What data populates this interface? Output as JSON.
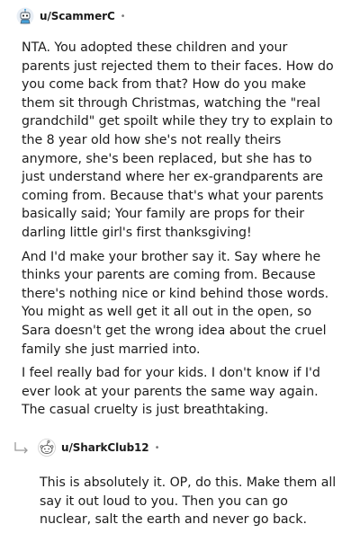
{
  "comments": [
    {
      "username": "u/ScammerC",
      "separator": "•",
      "avatar_icon": "robot-avatar-icon",
      "paragraphs": [
        "NTA. You adopted these children and your parents just rejected them to their faces. How do you come back from that? How do you make them sit through Christmas, watching the \"real grandchild\" get spoilt while they try to explain to the 8 year old how she's not really theirs anymore, she's been replaced, but she has to just understand where her ex-grandparents are coming from. Because that's what your parents basically said; Your family are props for their darling little girl's first thanksgiving!",
        "And I'd make your brother say it. Say where he thinks your parents are coming from. Because there's nothing nice or kind behind those words. You might as well get it all out in the open, so Sara doesn't get the wrong idea about the cruel family she just married into.",
        "I feel really bad for your kids. I don't know if I'd ever look at your parents the same way again. The casual cruelty is just breathtaking."
      ]
    },
    {
      "username": "u/SharkClub12",
      "separator": "•",
      "avatar_icon": "snoo-avatar-icon",
      "reply_icon": "reply-arrow-icon",
      "paragraphs": [
        "This is absolutely it. OP, do this. Make them all say it out loud to you. Then you can go nuclear, salt the earth and never go back."
      ]
    }
  ]
}
